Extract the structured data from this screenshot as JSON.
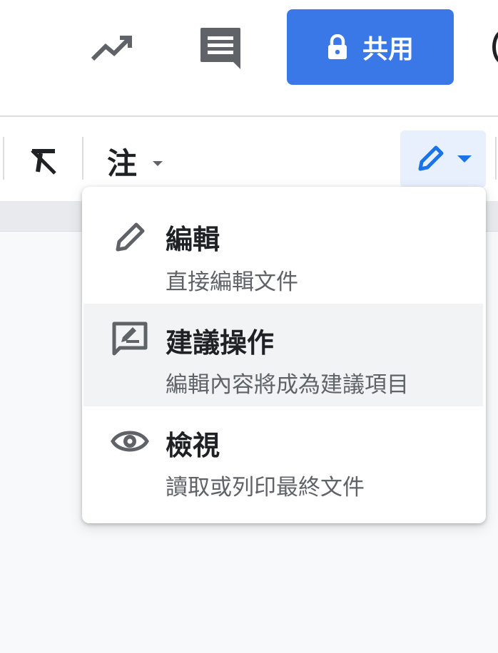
{
  "header": {
    "activity_icon": "trending-up-icon",
    "comments_icon": "comment-icon",
    "share_button": {
      "icon": "lock-icon",
      "label": "共用",
      "color": "#3b78e7"
    }
  },
  "toolbar": {
    "clear_format_icon": "clear-formatting-icon",
    "style_select": {
      "value": "注"
    },
    "mode_button": {
      "icon": "pencil-icon",
      "accent": "#1a73e8"
    }
  },
  "mode_menu": {
    "items": [
      {
        "icon": "pencil-icon",
        "title": "編輯",
        "description": "直接編輯文件",
        "highlighted": false
      },
      {
        "icon": "suggest-edit-icon",
        "title": "建議操作",
        "description": "編輯內容將成為建議項目",
        "highlighted": true
      },
      {
        "icon": "eye-icon",
        "title": "檢視",
        "description": "讀取或列印最終文件",
        "highlighted": false
      }
    ]
  }
}
